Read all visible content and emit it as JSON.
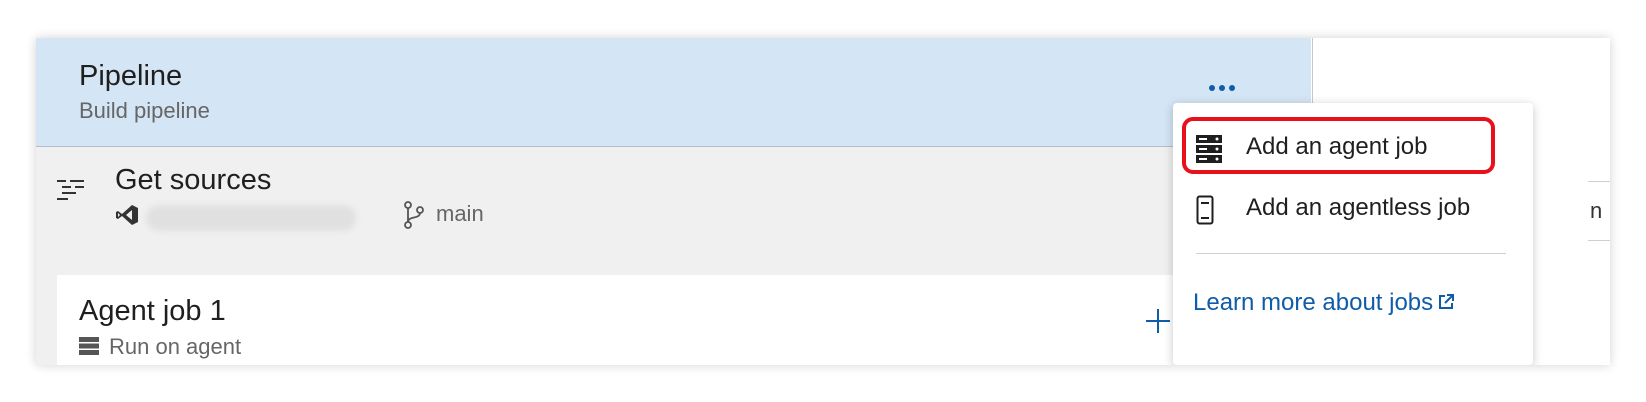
{
  "pipeline": {
    "title": "Pipeline",
    "subtitle": "Build pipeline",
    "more_icon": "ellipsis-icon"
  },
  "get_sources": {
    "title": "Get sources",
    "repo_icon": "visual-studio-icon",
    "repo_name": "",
    "branch_icon": "git-branch-icon",
    "branch": "main"
  },
  "agent_job": {
    "title": "Agent job 1",
    "subtitle": "Run on agent",
    "add_icon": "plus-icon"
  },
  "context_menu": {
    "items": [
      {
        "label": "Add an agent job",
        "icon": "server-icon",
        "highlighted": true
      },
      {
        "label": "Add an agentless job",
        "icon": "phone-icon",
        "highlighted": false
      }
    ],
    "learn_more_label": "Learn more about jobs",
    "learn_more_icon": "external-link-icon"
  },
  "right_panel_partial_text": "n",
  "colors": {
    "header_bg": "#d4e5f5",
    "accent": "#0f5ca8",
    "highlight": "#e8101a",
    "panel_bg": "#f0f0f0"
  }
}
